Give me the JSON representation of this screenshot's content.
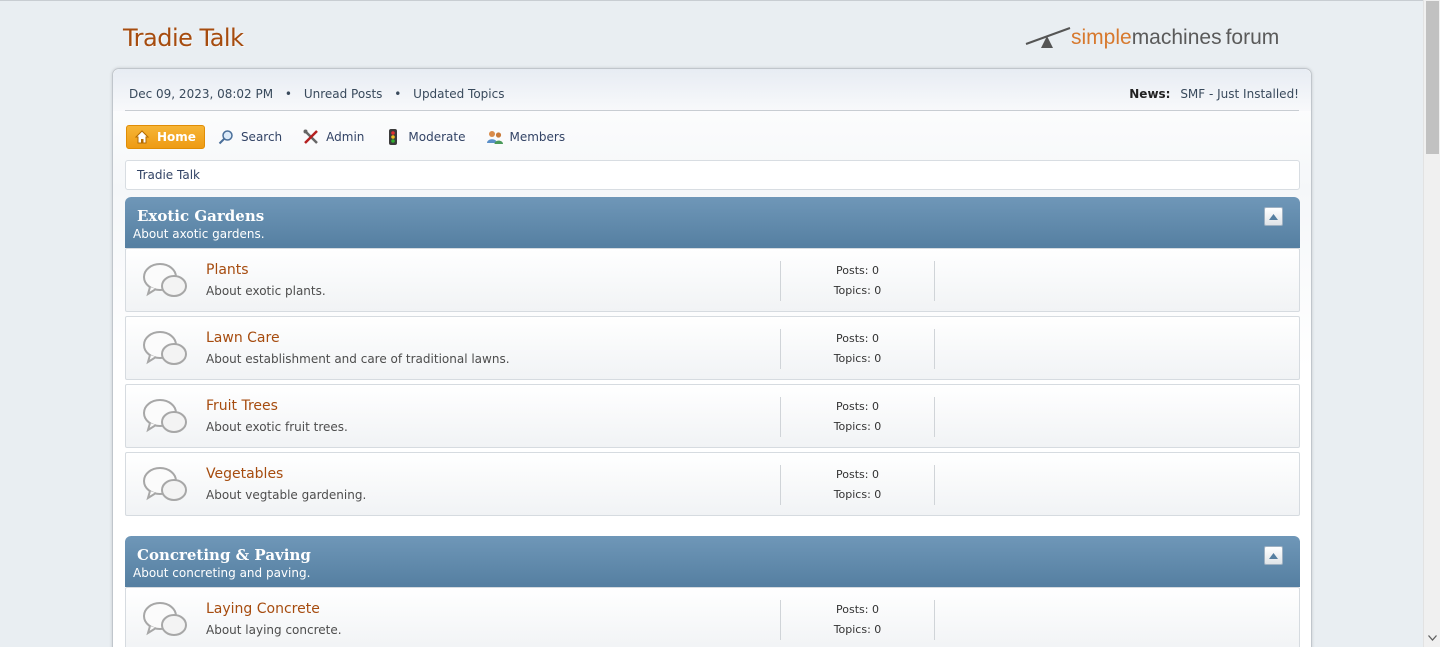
{
  "site": {
    "title": "Tradie Talk",
    "logo": {
      "word1": "simple",
      "word2": "machines",
      "word3": "forum"
    }
  },
  "topbar": {
    "datetime": "Dec 09, 2023, 08:02 PM",
    "links": [
      "Unread Posts",
      "Updated Topics"
    ],
    "news_label": "News:",
    "news_text": "SMF - Just Installed!"
  },
  "menu": [
    {
      "label": "Home",
      "icon": "home-icon",
      "active": true
    },
    {
      "label": "Search",
      "icon": "search-icon",
      "active": false
    },
    {
      "label": "Admin",
      "icon": "tools-icon",
      "active": false
    },
    {
      "label": "Moderate",
      "icon": "traffic-light-icon",
      "active": false
    },
    {
      "label": "Members",
      "icon": "members-icon",
      "active": false
    }
  ],
  "breadcrumb": "Tradie Talk",
  "categories": [
    {
      "title": "Exotic Gardens",
      "description": "About axotic gardens.",
      "boards": [
        {
          "name": "Plants",
          "description": "About exotic plants.",
          "posts": "Posts: 0",
          "topics": "Topics: 0"
        },
        {
          "name": "Lawn Care",
          "description": "About establishment and care of traditional lawns.",
          "posts": "Posts: 0",
          "topics": "Topics: 0"
        },
        {
          "name": "Fruit Trees",
          "description": "About exotic fruit trees.",
          "posts": "Posts: 0",
          "topics": "Topics: 0"
        },
        {
          "name": "Vegetables",
          "description": "About vegtable gardening.",
          "posts": "Posts: 0",
          "topics": "Topics: 0"
        }
      ]
    },
    {
      "title": "Concreting & Paving",
      "description": "About concreting and paving.",
      "boards": [
        {
          "name": "Laying Concrete",
          "description": "About laying concrete.",
          "posts": "Posts: 0",
          "topics": "Topics: 0"
        }
      ]
    }
  ],
  "colors": {
    "accent": "#a64c0f",
    "header_blue": "#5f88aa",
    "menu_active": "#f0a020"
  }
}
